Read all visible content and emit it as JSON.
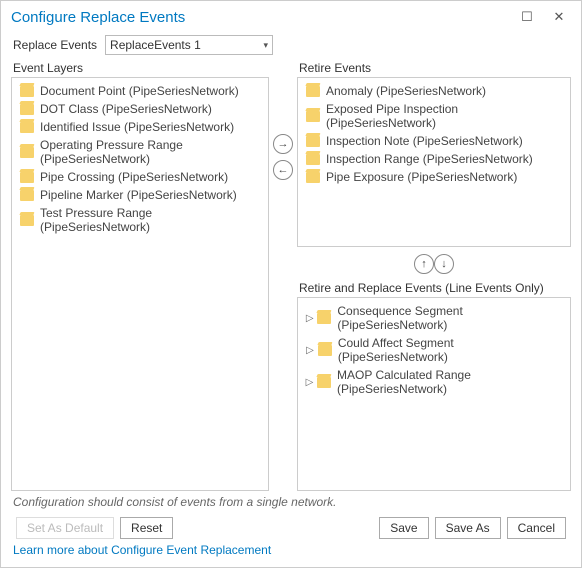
{
  "window": {
    "title": "Configure Replace Events"
  },
  "replace_events": {
    "label": "Replace Events",
    "value": "ReplaceEvents 1"
  },
  "panels": {
    "event_layers_title": "Event Layers",
    "retire_title": "Retire Events",
    "retire_replace_title": "Retire and Replace Events (Line Events Only)"
  },
  "event_layers": [
    {
      "label": "Document Point (PipeSeriesNetwork)"
    },
    {
      "label": "DOT Class (PipeSeriesNetwork)"
    },
    {
      "label": "Identified Issue (PipeSeriesNetwork)"
    },
    {
      "label": "Operating Pressure Range (PipeSeriesNetwork)"
    },
    {
      "label": "Pipe Crossing (PipeSeriesNetwork)"
    },
    {
      "label": "Pipeline Marker (PipeSeriesNetwork)"
    },
    {
      "label": "Test Pressure Range (PipeSeriesNetwork)"
    }
  ],
  "retire_events": [
    {
      "label": "Anomaly (PipeSeriesNetwork)"
    },
    {
      "label": "Exposed Pipe Inspection (PipeSeriesNetwork)"
    },
    {
      "label": "Inspection Note (PipeSeriesNetwork)"
    },
    {
      "label": "Inspection Range (PipeSeriesNetwork)"
    },
    {
      "label": "Pipe Exposure (PipeSeriesNetwork)"
    }
  ],
  "retire_replace_events": [
    {
      "label": "Consequence Segment (PipeSeriesNetwork)"
    },
    {
      "label": "Could Affect Segment (PipeSeriesNetwork)"
    },
    {
      "label": "MAOP Calculated Range (PipeSeriesNetwork)"
    }
  ],
  "hint": "Configuration should consist of events from a single network.",
  "buttons": {
    "set_default": "Set As Default",
    "reset": "Reset",
    "save": "Save",
    "save_as": "Save As",
    "cancel": "Cancel"
  },
  "link": "Learn more about Configure Event Replacement",
  "glyphs": {
    "right": "→",
    "left": "←",
    "up": "↑",
    "down": "↓",
    "tri": "▷",
    "caret": "▾",
    "max": "☐",
    "close": "✕"
  }
}
